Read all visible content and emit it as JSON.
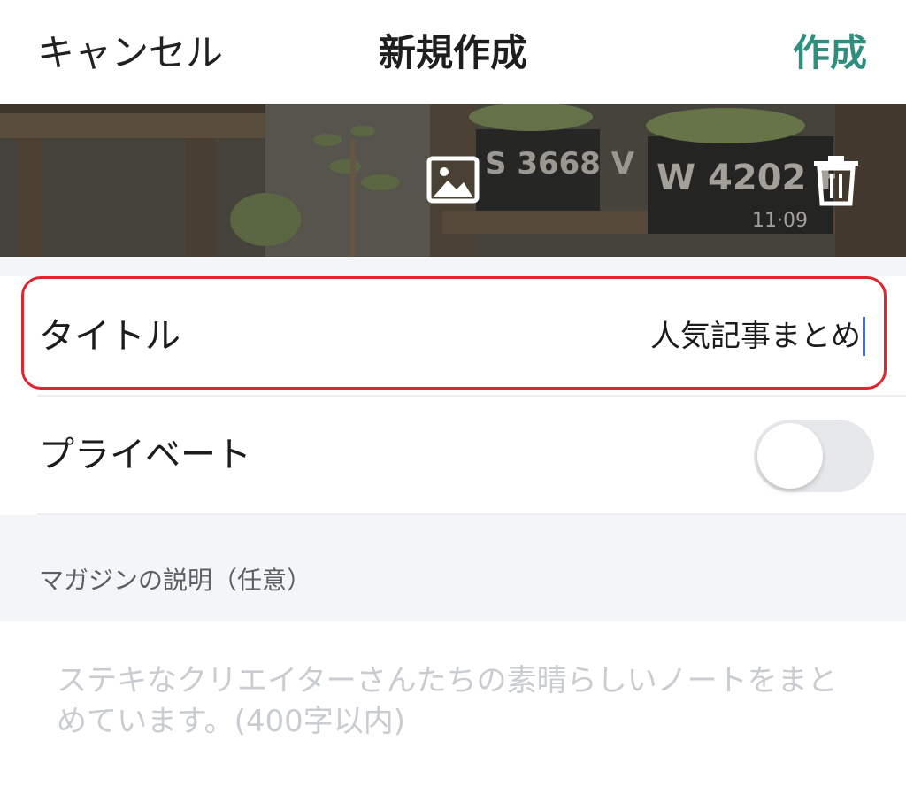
{
  "header": {
    "cancel_label": "キャンセル",
    "title": "新規作成",
    "create_label": "作成"
  },
  "cover": {
    "change_image_icon": "image-icon",
    "delete_icon": "trash-icon"
  },
  "form": {
    "title_label": "タイトル",
    "title_value": "人気記事まとめ",
    "private_label": "プライベート",
    "private_enabled": false,
    "description_section_label": "マガジンの説明（任意）",
    "description_placeholder": "ステキなクリエイターさんたちの素晴らしいノートをまとめています。(400字以内)"
  },
  "colors": {
    "accent": "#2e8f7e",
    "highlight": "#e0252f",
    "caret": "#3b6fe0"
  }
}
